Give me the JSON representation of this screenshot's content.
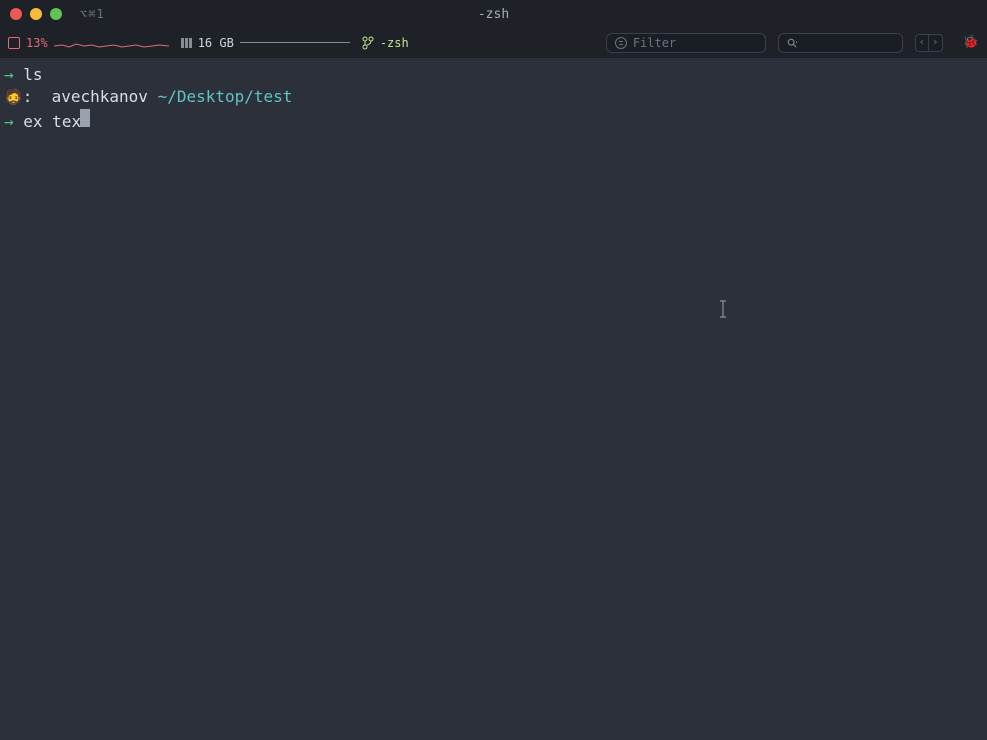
{
  "window": {
    "title": "-zsh",
    "tab_indicator": "⌥⌘1"
  },
  "statusbar": {
    "cpu_percent": "13%",
    "ram_size": "16 GB",
    "branch_name": "-zsh",
    "filter_placeholder": "Filter",
    "bug_emoji": "🐞"
  },
  "terminal": {
    "lines": [
      {
        "prompt_arrow": "→",
        "command": "ls"
      }
    ],
    "prompt": {
      "emoji": "🧔",
      "colon": ":",
      "user": "avechkanov",
      "path": "~/Desktop/test"
    },
    "current_line": {
      "prompt_arrow": "→",
      "command": "ex tex"
    }
  },
  "nav": {
    "prev": "‹",
    "next": "›"
  }
}
